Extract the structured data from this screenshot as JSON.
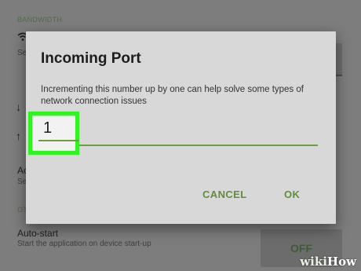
{
  "background": {
    "section_header": "BANDWIDTH",
    "rows": [
      {
        "icon": "wifi-icon",
        "title": "",
        "subtitle": "Se"
      },
      {
        "icon": "arrow-down-icon",
        "title": "",
        "subtitle": ""
      },
      {
        "icon": "arrow-up-icon",
        "title": "",
        "subtitle": ""
      },
      {
        "icon": "",
        "title": "Ac",
        "subtitle": "Se"
      }
    ],
    "other_header": "OT",
    "autostart": {
      "title": "Auto-start",
      "subtitle": "Start the application on device start-up",
      "toggle_label": "OFF"
    }
  },
  "dialog": {
    "title": "Incoming Port",
    "message": "Incrementing this number up by one can help solve some types of network connection issues",
    "input_value": "1",
    "cancel_label": "CANCEL",
    "ok_label": "OK"
  },
  "watermark": {
    "wiki": "wiki",
    "how": "How"
  },
  "colors": {
    "accent": "#5f8f3a",
    "highlight": "#2ff41f",
    "dialog_bg": "#d8d8d8",
    "scrim": "#7d7d7d"
  }
}
